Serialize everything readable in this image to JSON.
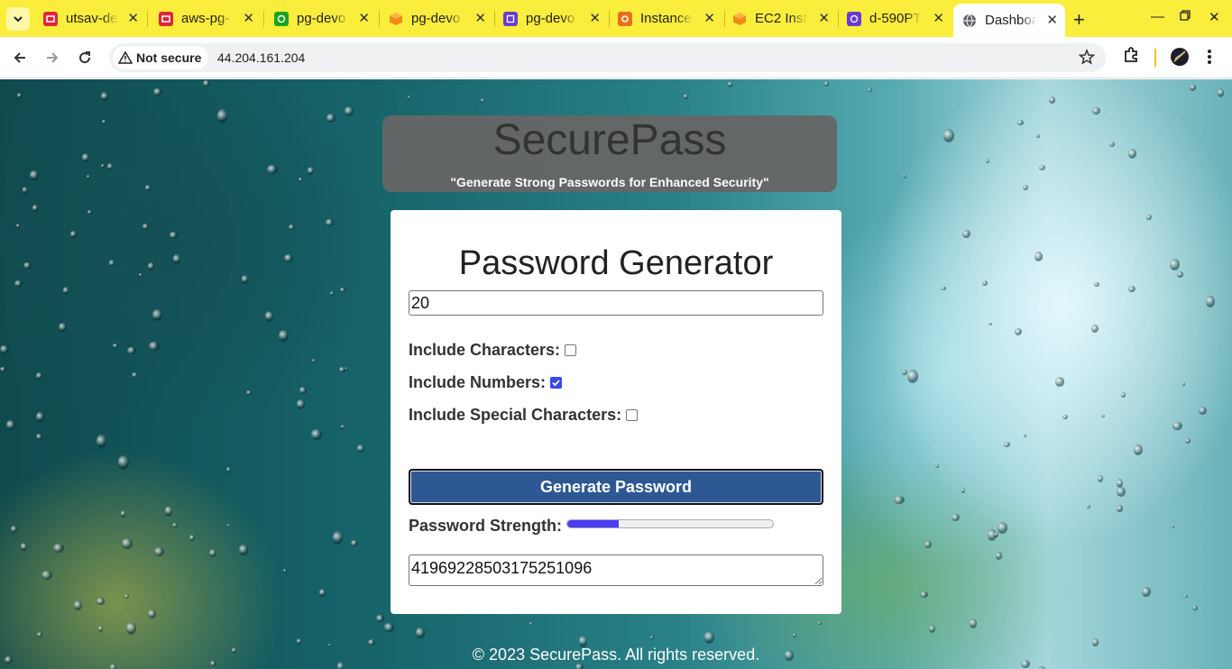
{
  "browser": {
    "tabs": [
      {
        "title": "utsav-de",
        "favicon": "aws-icon",
        "color": "#e0243c"
      },
      {
        "title": "aws-pg-",
        "favicon": "aws-icon",
        "color": "#e0243c"
      },
      {
        "title": "pg-devo",
        "favicon": "pipeline-icon",
        "color": "#1aa51c"
      },
      {
        "title": "pg-devo",
        "favicon": "cube-icon",
        "color": "#f08a11"
      },
      {
        "title": "pg-devo",
        "favicon": "codebuild-icon",
        "color": "#6a3bd1"
      },
      {
        "title": "Instance",
        "favicon": "gear-icon",
        "color": "#e8701a"
      },
      {
        "title": "EC2 Inst",
        "favicon": "cube-icon",
        "color": "#f08a11"
      },
      {
        "title": "d-590PT",
        "favicon": "directory-icon",
        "color": "#6a3bd1"
      },
      {
        "title": "Dashboa",
        "favicon": "globe-icon",
        "color": "#555555",
        "active": true
      }
    ],
    "security_label": "Not secure",
    "url": "44.204.161.204",
    "accent_color": "#fbed3c"
  },
  "banner": {
    "title": "SecurePass",
    "tagline": "\"Generate Strong Passwords for Enhanced Security\""
  },
  "generator": {
    "heading": "Password Generator",
    "length_value": "20",
    "options": [
      {
        "label": "Include Characters:",
        "checked": false
      },
      {
        "label": "Include Numbers:",
        "checked": true
      },
      {
        "label": "Include Special Characters:",
        "checked": false
      }
    ],
    "generate_label": "Generate Password",
    "strength_label": "Password Strength:",
    "strength_level": 0.25,
    "output": "41969228503175251096"
  },
  "footer": {
    "text": "© 2023 SecurePass. All rights reserved."
  }
}
